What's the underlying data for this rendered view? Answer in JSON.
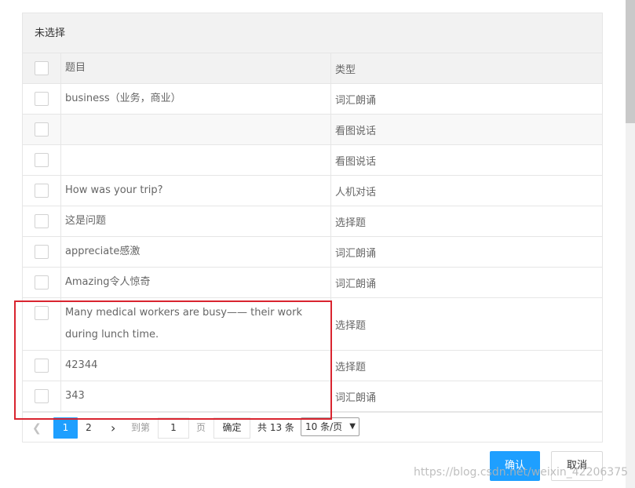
{
  "panel": {
    "header": "未选择"
  },
  "table": {
    "columns": {
      "title": "题目",
      "type": "类型"
    },
    "rows": [
      {
        "title": "business（业务，商业）",
        "type": "词汇朗诵"
      },
      {
        "title": "",
        "type": "看图说话"
      },
      {
        "title": "",
        "type": "看图说话"
      },
      {
        "title": "How was your trip?",
        "type": "人机对话"
      },
      {
        "title": "这是问题",
        "type": "选择题"
      },
      {
        "title": "appreciate感激",
        "type": "词汇朗诵"
      },
      {
        "title": "Amazing令人惊奇",
        "type": "词汇朗诵"
      },
      {
        "title": "Many medical workers are busy—— their work during lunch time.",
        "type": "选择题"
      },
      {
        "title": "42344",
        "type": "选择题"
      },
      {
        "title": "343",
        "type": "词汇朗诵"
      }
    ]
  },
  "pager": {
    "current_page": "1",
    "other_page": "2",
    "goto_label": "到第",
    "goto_value": "1",
    "page_suffix": "页",
    "confirm_label": "确定",
    "total_label": "共 13 条",
    "page_size": "10 条/页"
  },
  "actions": {
    "ok": "确认",
    "cancel": "取消"
  },
  "watermark": "https://blog.csdn.net/weixin_42206375",
  "colors": {
    "accent": "#1e9fff",
    "highlight": "#d9242f"
  }
}
